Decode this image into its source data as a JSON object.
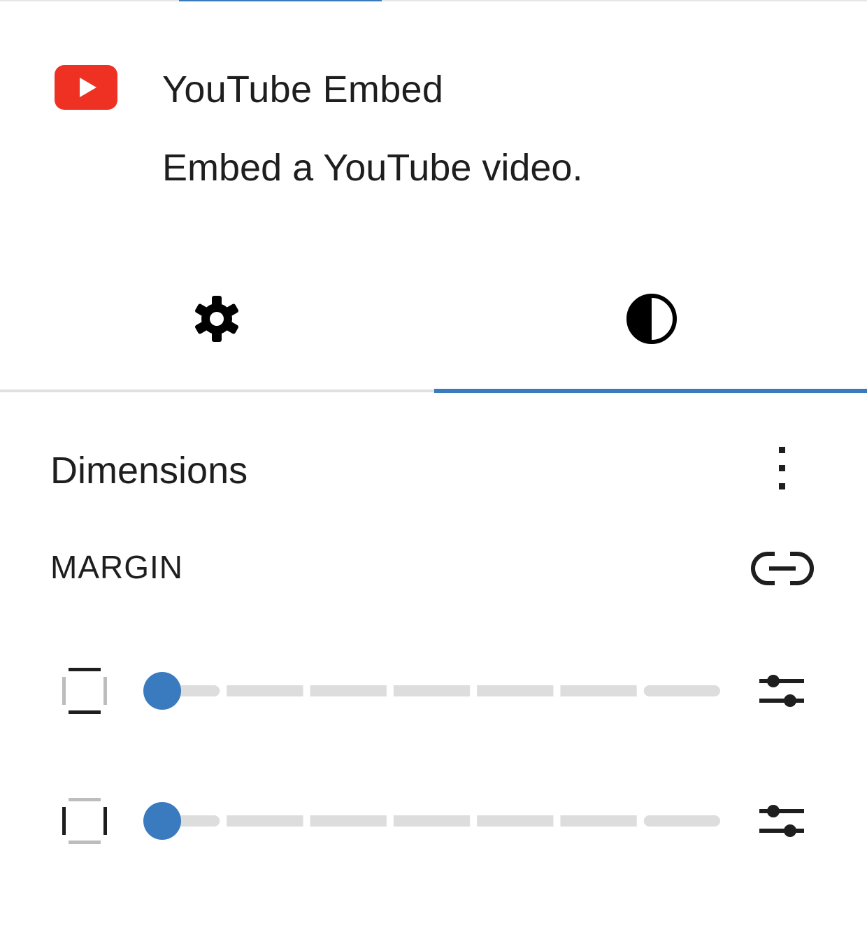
{
  "block": {
    "icon": "youtube-logo-icon",
    "title": "YouTube Embed",
    "description": "Embed a YouTube video."
  },
  "tabs": [
    {
      "name": "settings",
      "icon": "gear-icon",
      "active": false
    },
    {
      "name": "styles",
      "icon": "half-circle-contrast-icon",
      "active": true
    }
  ],
  "panel": {
    "title": "Dimensions",
    "options_icon": "vertical-ellipsis-icon",
    "margin": {
      "label": "MARGIN",
      "link_icon": "unlink-icon",
      "rows": [
        {
          "side_icon": "vertical-sides-icon",
          "value": 0,
          "steps": 7,
          "custom_icon": "sliders-icon"
        },
        {
          "side_icon": "horizontal-sides-icon",
          "value": 0,
          "steps": 7,
          "custom_icon": "sliders-icon"
        }
      ]
    }
  },
  "colors": {
    "accent": "#3a7bbf",
    "youtube_red": "#ef3124",
    "text": "#1e1e1e",
    "track": "#dddddd"
  }
}
